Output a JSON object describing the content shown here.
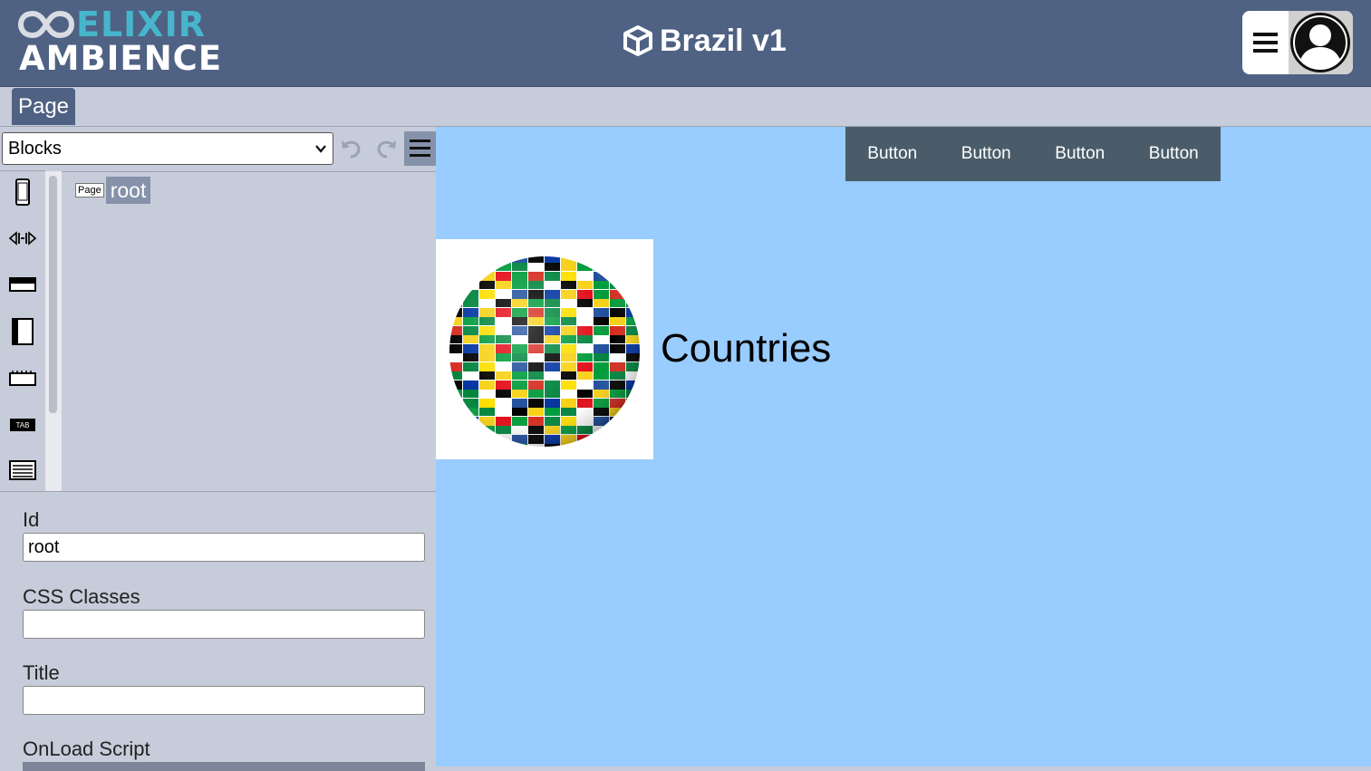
{
  "header": {
    "logo_top": "ELIXIR",
    "logo_bottom": "AMBIENCE",
    "app_title": "Brazil v1",
    "icons": [
      "infinity-icon",
      "cube-icon",
      "hamburger-menu-icon",
      "user-avatar-icon"
    ]
  },
  "tabs": {
    "page": "Page"
  },
  "left_panel": {
    "blocks_select": "Blocks",
    "tools": [
      "phone-icon",
      "resize-horizontal-icon",
      "header-block-icon",
      "sidebar-block-icon",
      "panel-block-icon",
      "tab-block-icon",
      "list-block-icon"
    ],
    "tab_tool_text": "TAB",
    "tree": {
      "chip": "Page",
      "label": "root"
    },
    "properties": {
      "id_label": "Id",
      "id_value": "root",
      "css_label": "CSS Classes",
      "css_value": "",
      "title_label": "Title",
      "title_value": "",
      "onload_label": "OnLoad Script"
    }
  },
  "canvas": {
    "buttons": [
      "Button",
      "Button",
      "Button",
      "Button"
    ],
    "heading": "Countries",
    "colors": {
      "background": "#99ccff",
      "nav": "#4a5c6a"
    }
  }
}
